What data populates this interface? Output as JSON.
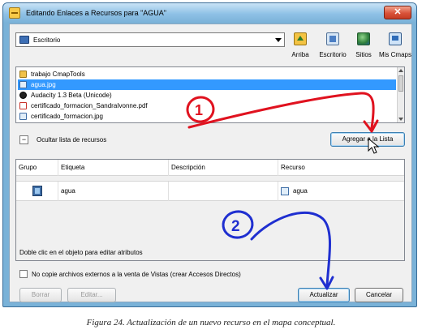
{
  "window": {
    "title": "Editando Enlaces a Recursos para \"AGUA\"",
    "close_glyph": "✕"
  },
  "location": {
    "current": "Escritorio",
    "icon": "desktop-icon"
  },
  "nav": [
    {
      "label": "Arriba",
      "icon": "folder-up-icon"
    },
    {
      "label": "Escritorio",
      "icon": "desktop-icon"
    },
    {
      "label": "Sitios",
      "icon": "globe-icon"
    },
    {
      "label": "Mis Cmaps",
      "icon": "computer-icon"
    }
  ],
  "files": [
    {
      "name": "trabajo CmapTools",
      "icon": "folder-icon",
      "selected": false
    },
    {
      "name": "agua.jpg",
      "icon": "image-icon",
      "selected": true
    },
    {
      "name": "Audacity 1.3 Beta (Unicode)",
      "icon": "app-icon",
      "selected": false
    },
    {
      "name": "certificado_formacion_SandraIvonne.pdf",
      "icon": "pdf-icon",
      "selected": false
    },
    {
      "name": "certificado_formacion.jpg",
      "icon": "image-icon",
      "selected": false
    }
  ],
  "hide_list": {
    "toggle_glyph": "−",
    "label": "Ocultar lista de recursos"
  },
  "add_button": "Agregar a la Lista",
  "table": {
    "columns": [
      "Grupo",
      "Etiqueta",
      "Descripción",
      "Recurso"
    ],
    "rows": [
      {
        "group_icon": "image-icon",
        "etiqueta": "agua",
        "descripcion": "",
        "recurso": "agua",
        "recurso_icon": "image-icon"
      }
    ],
    "footer_hint": "Doble clic en el objeto para editar atributos"
  },
  "no_copy": {
    "checked": false,
    "label": "No copie archivos externos a la venta de Vistas (crear Accesos Directos)"
  },
  "buttons": {
    "borrar": "Borrar",
    "editar": "Editar...",
    "actualizar": "Actualizar",
    "cancelar": "Cancelar"
  },
  "annotations": {
    "step1": "1",
    "step2": "2",
    "color": "#e0121f",
    "color2": "#1f2fd0"
  },
  "caption": "Figura 24. Actualización de un nuevo recurso en el mapa conceptual."
}
